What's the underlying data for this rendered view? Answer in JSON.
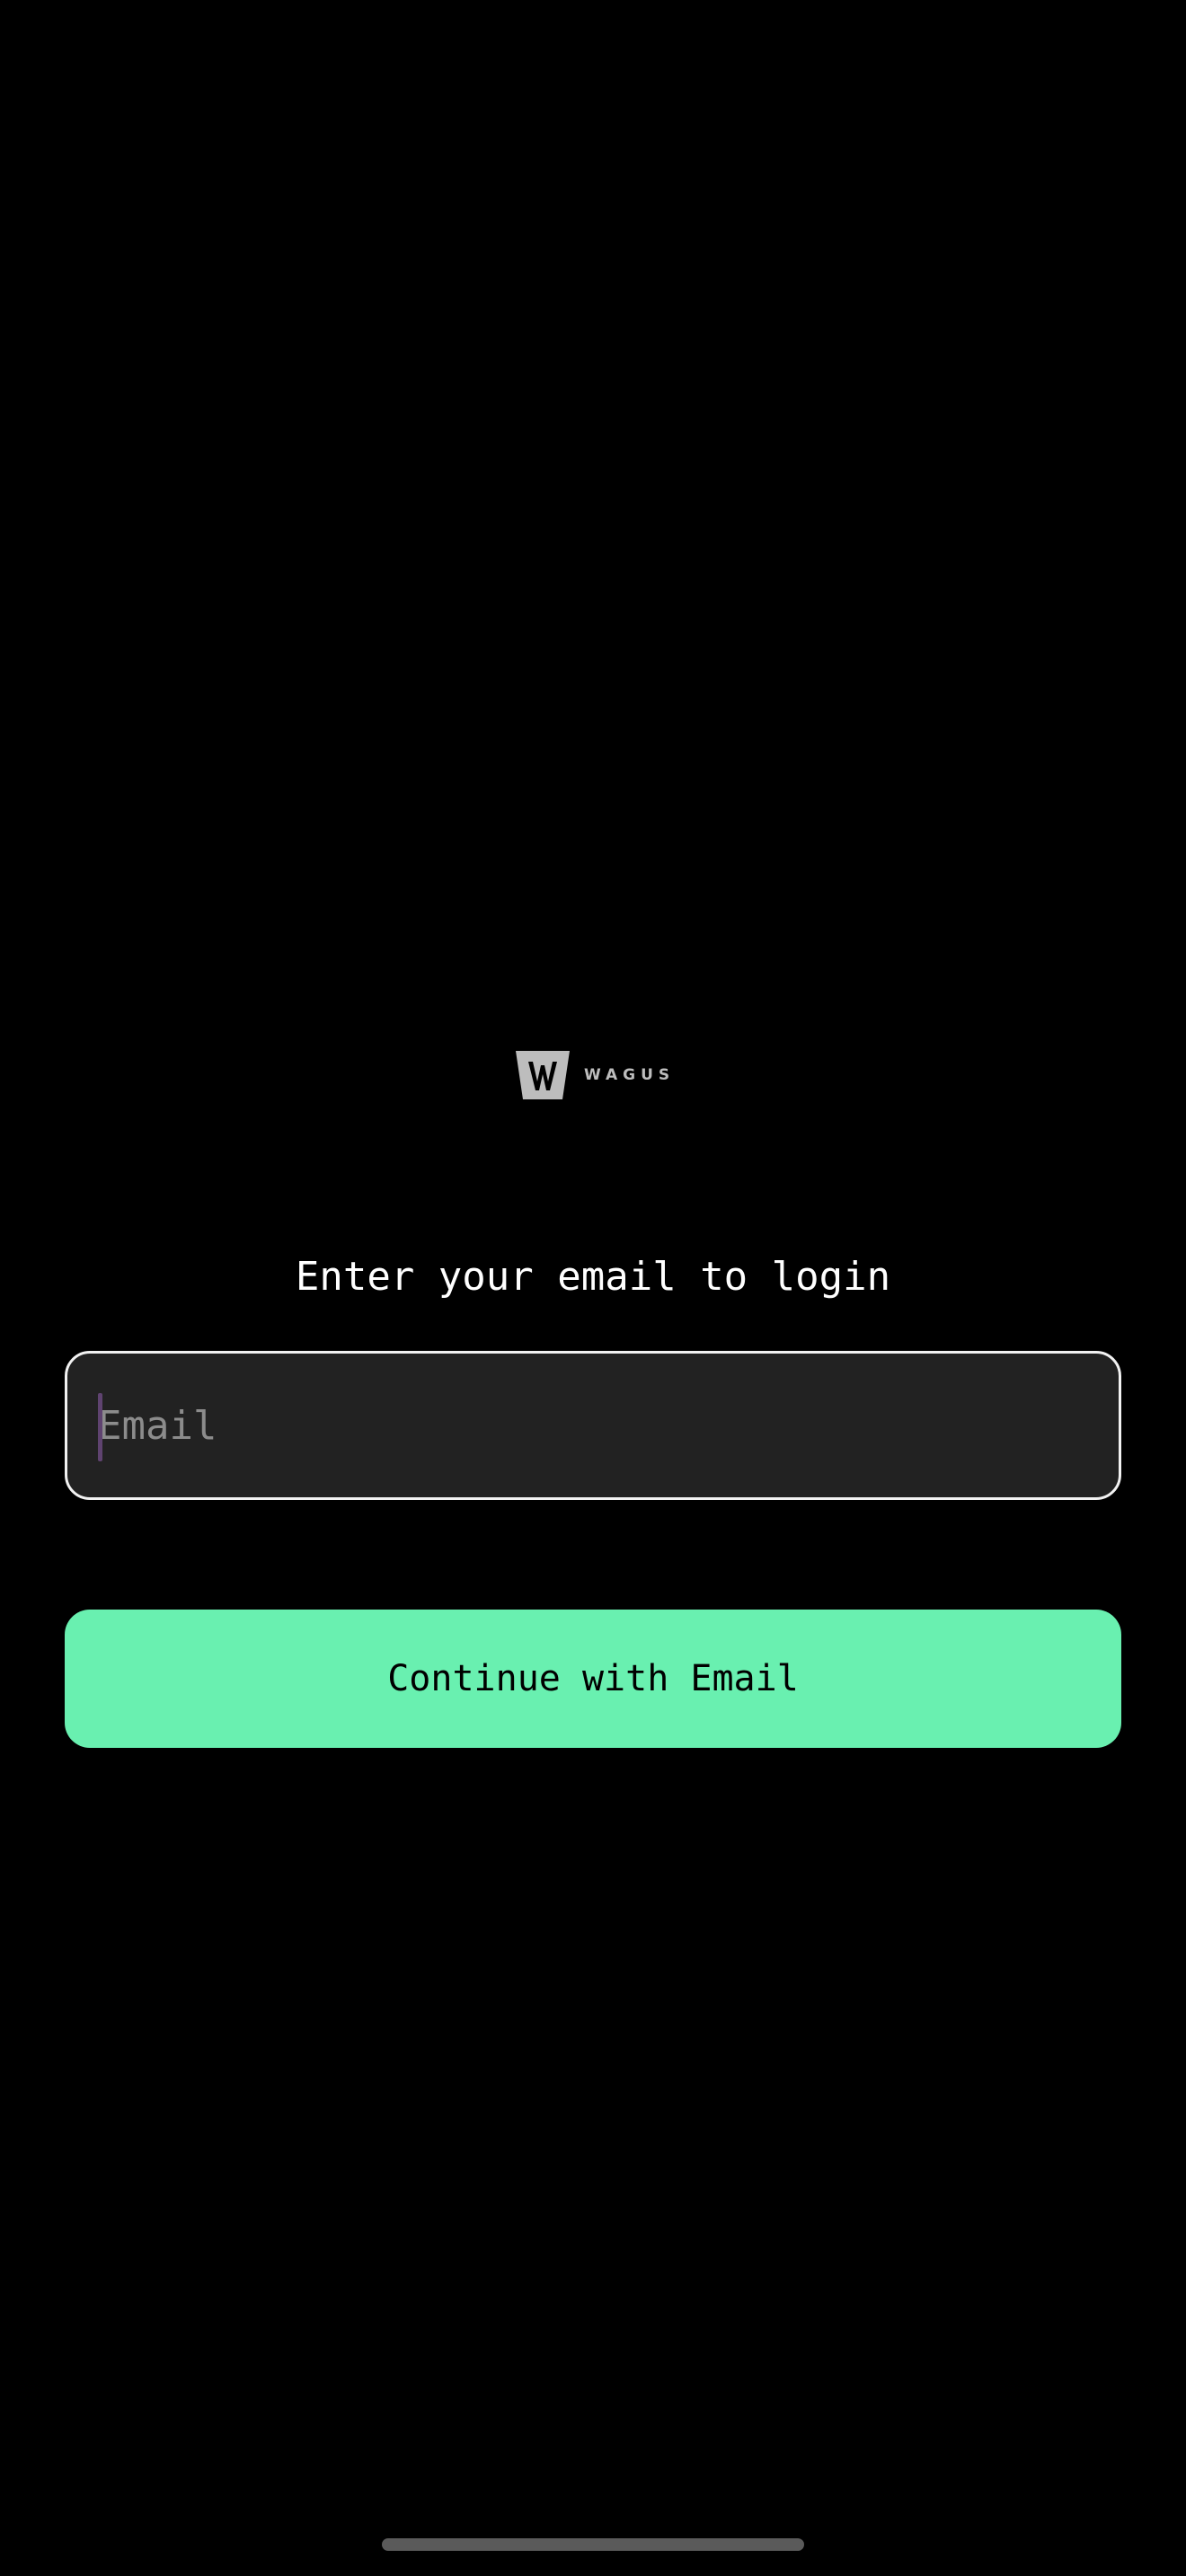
{
  "brand": {
    "name": "WAGUS",
    "logo_icon": "wagus-w-logo-icon",
    "logo_color": "#bdbdbd"
  },
  "login": {
    "heading": "Enter your email to login",
    "email_placeholder": "Email",
    "email_value": "",
    "continue_label": "Continue with Email"
  },
  "colors": {
    "background": "#000000",
    "field_background": "#222222",
    "field_border": "#f2f2f2",
    "button_accent": "#69f0b0",
    "caret": "#5f4370"
  }
}
